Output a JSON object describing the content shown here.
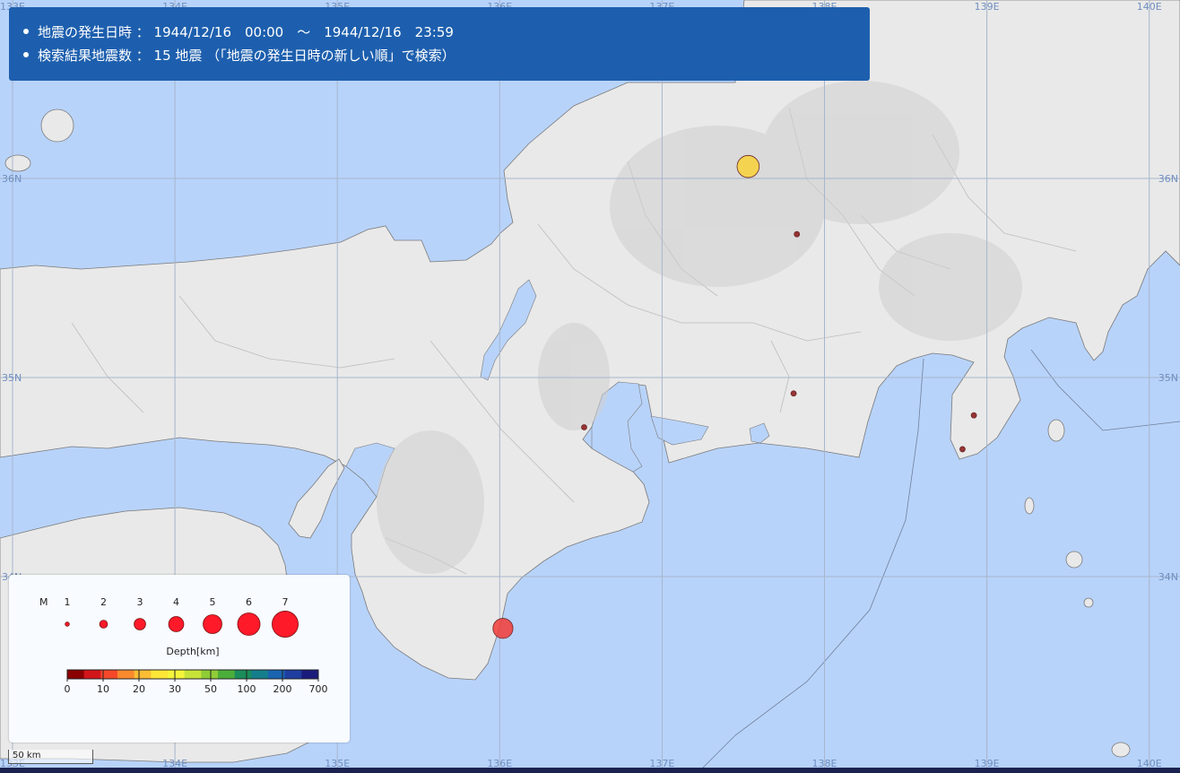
{
  "info": {
    "line1": "地震の発生日時 ： 1944/12/16　00:00　～　1944/12/16　23:59",
    "line2": "検索結果地震数 ： 15 地震 （「地震の発生日時の新しい順」で検索）"
  },
  "grid": {
    "lon_labels": [
      "133E",
      "134E",
      "135E",
      "136E",
      "137E",
      "138E",
      "139E",
      "140E"
    ],
    "lat_labels": [
      "36N",
      "35N",
      "34N"
    ]
  },
  "legend": {
    "magnitude_label": "M",
    "magnitudes": [
      "1",
      "2",
      "3",
      "4",
      "5",
      "6",
      "7"
    ],
    "depth_title": "Depth[km]",
    "depth_ticks": [
      "0",
      "10",
      "20",
      "30",
      "50",
      "100",
      "200",
      "700"
    ],
    "depth_colors": [
      "#8b0000",
      "#d2151b",
      "#f5482a",
      "#f98a2d",
      "#fbbd34",
      "#fde636",
      "#f4f53a",
      "#c7e33a",
      "#8fcc36",
      "#4cae3a",
      "#1a8d5a",
      "#157e8c",
      "#1a64b0",
      "#1f3ea0",
      "#1b1b7c"
    ]
  },
  "scale_label": "50 km",
  "colors": {
    "sea": "#b8d3fa",
    "land": "#e9e9e9",
    "panel": "#1d5fae"
  },
  "earthquakes": [
    {
      "lon": 137.53,
      "lat": 36.06,
      "magnitude": 5.4,
      "depth_color": "#f7d23e"
    },
    {
      "lon": 136.02,
      "lat": 33.74,
      "magnitude": 4.9,
      "depth_color": "#f0403b"
    },
    {
      "lon": 137.83,
      "lat": 35.72,
      "magnitude": 1.5,
      "depth_color": "#8b1a1a"
    },
    {
      "lon": 137.81,
      "lat": 34.92,
      "magnitude": 1.5,
      "depth_color": "#8b1a1a"
    },
    {
      "lon": 136.52,
      "lat": 34.75,
      "magnitude": 1.5,
      "depth_color": "#8b1a1a"
    },
    {
      "lon": 138.92,
      "lat": 34.81,
      "magnitude": 1.5,
      "depth_color": "#8b1a1a"
    },
    {
      "lon": 138.85,
      "lat": 34.64,
      "magnitude": 1.5,
      "depth_color": "#8b1a1a"
    }
  ]
}
